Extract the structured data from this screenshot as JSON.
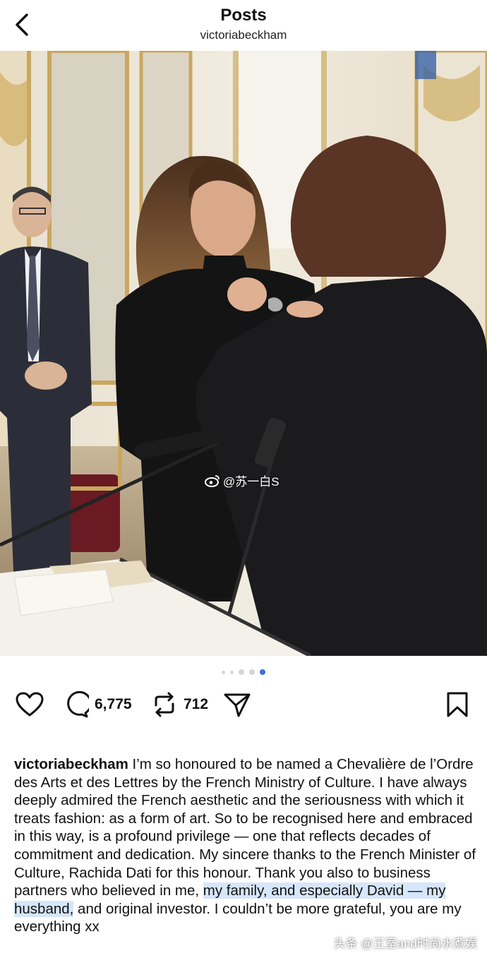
{
  "header": {
    "title": "Posts",
    "username": "victoriabeckham",
    "back_icon": "chevron-left-icon"
  },
  "photo": {
    "watermark_text": "@苏一白S",
    "watermark_icon": "weibo-icon"
  },
  "carousel": {
    "count": 5,
    "active_index": 4
  },
  "actions": {
    "like_icon": "heart-icon",
    "comment_icon": "comment-icon",
    "comment_count": "6,775",
    "repost_icon": "repost-icon",
    "repost_count": "712",
    "share_icon": "send-icon",
    "save_icon": "bookmark-icon"
  },
  "caption": {
    "username": "victoriabeckham",
    "text_before": " I’m so honoured to be named a Chevalière de l’Ordre des Arts et des Lettres by the French Ministry of Culture. I have always deeply admired the French aesthetic and the seriousness with which it treats fashion: as a form of art. So to be recognised here and embraced in this way, is a profound privilege — one that reflects decades of commitment and dedication. My sincere thanks to the French Minister of Culture, Rachida Dati for this honour. Thank you also to business partners who believed in me, ",
    "text_highlighted": "my family, and especially David — my husband,",
    "text_after": " and original investor. I couldn’t be more grateful, you are my everything xx"
  },
  "source_watermark": "头条 @王室and时尚水煮娱"
}
